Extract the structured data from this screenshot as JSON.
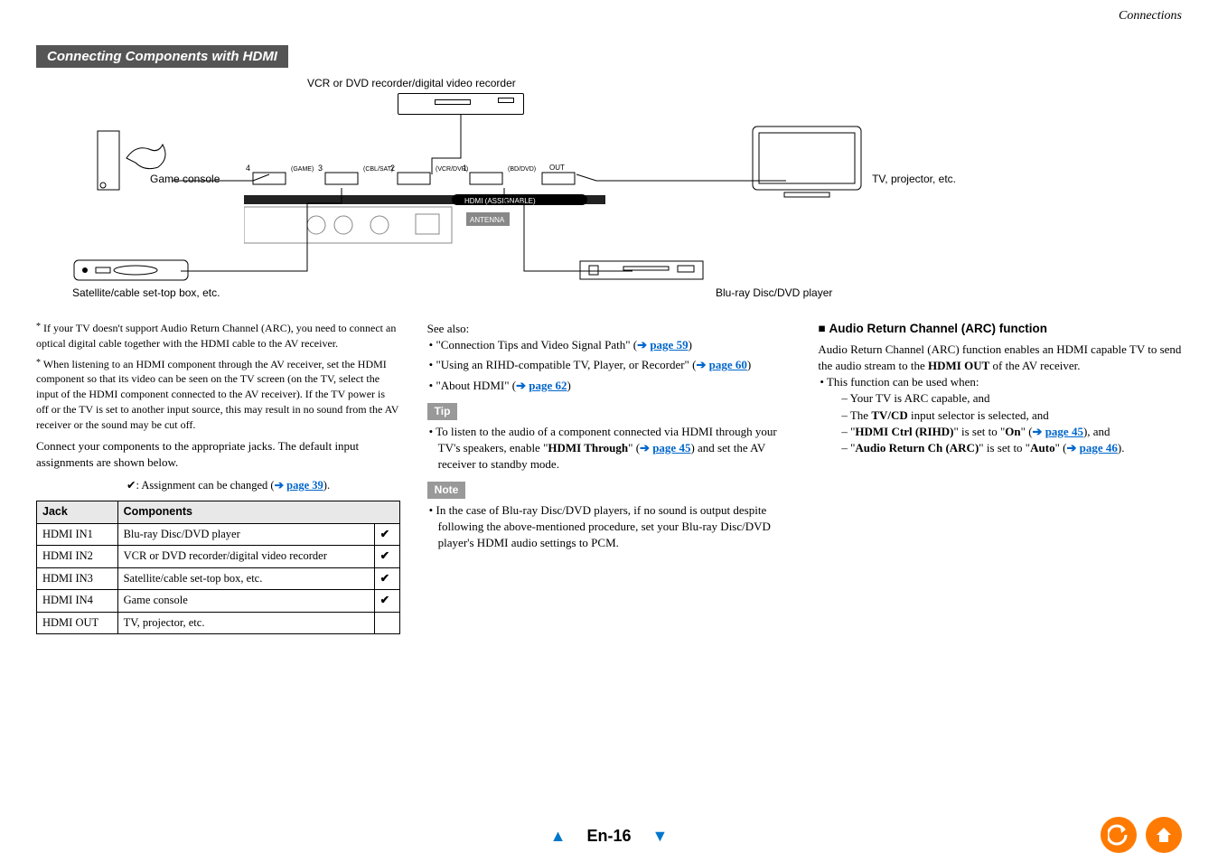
{
  "header": {
    "category": "Connections"
  },
  "section_title": "Connecting Components with HDMI",
  "diagram": {
    "labels": {
      "vcr": "VCR or DVD recorder/digital video recorder",
      "game": "Game console",
      "tv": "TV, projector, etc.",
      "stb": "Satellite/cable set-top box, etc.",
      "bd": "Blu-ray Disc/DVD player"
    },
    "receiver_ports": {
      "p4": "4",
      "p4_lbl": "(GAME)",
      "p3": "3",
      "p3_lbl": "(CBL/SAT)",
      "p2": "2",
      "p2_lbl": "(VCR/DVR)",
      "p1": "1",
      "p1_lbl": "(BD/DVD)",
      "out": "OUT",
      "grp": "HDMI (ASSIGNABLE)"
    }
  },
  "col1": {
    "foot1": "If your TV doesn't support Audio Return Channel (ARC), you need to connect an optical digital cable together with the HDMI cable to the AV receiver.",
    "foot2": "When listening to an HDMI component through the AV receiver, set the HDMI component so that its video can be seen on the TV screen (on the TV, select the input of the HDMI component connected to the AV receiver). If the TV power is off or the TV is set to another input source, this may result in no sound from the AV receiver or the sound may be cut off.",
    "intro": "Connect your components to the appropriate jacks. The default input assignments are shown below.",
    "legend_pre": "✔: Assignment can be changed (",
    "legend_link": "page 39",
    "legend_post": ").",
    "table": {
      "h1": "Jack",
      "h2": "Components",
      "rows": [
        {
          "jack": "HDMI IN1",
          "comp": "Blu-ray Disc/DVD player",
          "check": "✔"
        },
        {
          "jack": "HDMI IN2",
          "comp": "VCR or DVD recorder/digital video recorder",
          "check": "✔"
        },
        {
          "jack": "HDMI IN3",
          "comp": "Satellite/cable set-top box, etc.",
          "check": "✔"
        },
        {
          "jack": "HDMI IN4",
          "comp": "Game console",
          "check": "✔"
        },
        {
          "jack": "HDMI OUT",
          "comp": "TV, projector, etc.",
          "check": ""
        }
      ]
    }
  },
  "col2": {
    "see_also": "See also:",
    "b1_pre": "\"Connection Tips and Video Signal Path\" (",
    "b1_link": "page 59",
    "b1_post": ")",
    "b2_pre": "\"Using an RIHD-compatible TV, Player, or Recorder\" (",
    "b2_link": "page 60",
    "b2_post": ")",
    "b3_pre": "\"About HDMI\" (",
    "b3_link": "page 62",
    "b3_post": ")",
    "tip_label": "Tip",
    "tip_pre": "To listen to the audio of a component connected via HDMI through your TV's speakers, enable \"",
    "tip_bold": "HDMI Through",
    "tip_mid": "\" (",
    "tip_link": "page 45",
    "tip_post": ") and set the AV receiver to standby mode.",
    "note_label": "Note",
    "note_text": "In the case of Blu-ray Disc/DVD players, if no sound is output despite following the above-mentioned procedure, set your Blu-ray Disc/DVD player's HDMI audio settings to PCM."
  },
  "col3": {
    "subhead": "Audio Return Channel (ARC) function",
    "p1_pre": "Audio Return Channel (ARC) function enables an HDMI capable TV to send the audio stream to the ",
    "p1_bold": "HDMI OUT",
    "p1_post": " of the AV receiver.",
    "b_intro": "This function can be used when:",
    "d1": "Your TV is ARC capable, and",
    "d2_pre": "The ",
    "d2_bold": "TV/CD",
    "d2_post": " input selector is selected, and",
    "d3_pre": "\"",
    "d3_bold": "HDMI Ctrl (RIHD)",
    "d3_mid1": "\" is set to \"",
    "d3_bold2": "On",
    "d3_mid2": "\" (",
    "d3_link": "page 45",
    "d3_post": "), and",
    "d4_pre": "\"",
    "d4_bold": "Audio Return Ch (ARC)",
    "d4_mid1": "\" is set to \"",
    "d4_bold2": "Auto",
    "d4_mid2": "\" (",
    "d4_link": "page 46",
    "d4_post": ")."
  },
  "footer": {
    "page": "En-16",
    "arrow": "➔"
  }
}
